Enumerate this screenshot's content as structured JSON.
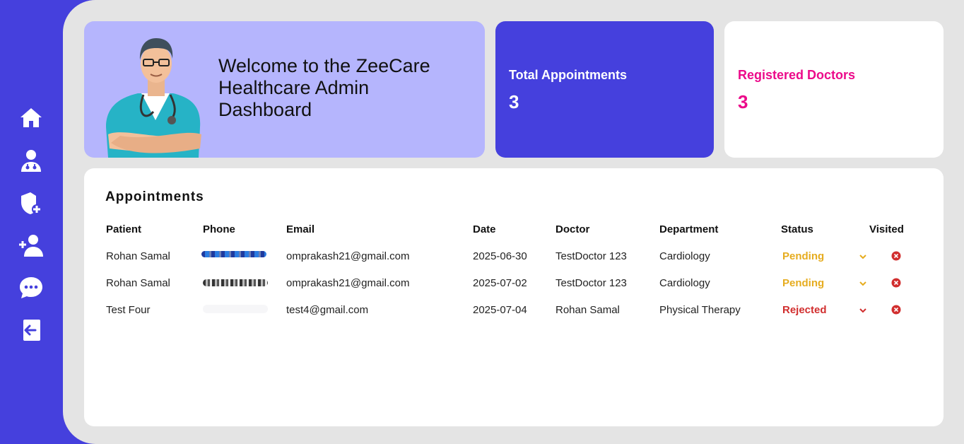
{
  "sidebar": {
    "items": [
      {
        "icon": "home-icon"
      },
      {
        "icon": "doctor-icon"
      },
      {
        "icon": "add-admin-shield-icon"
      },
      {
        "icon": "add-doctor-icon"
      },
      {
        "icon": "messages-icon"
      },
      {
        "icon": "logout-icon"
      }
    ]
  },
  "welcome": {
    "line1": "Welcome to the ZeeCare",
    "line2": "Healthcare Admin",
    "line3": "Dashboard"
  },
  "stats": {
    "appointments_label": "Total Appointments",
    "appointments_value": "3",
    "doctors_label": "Registered Doctors",
    "doctors_value": "3"
  },
  "appointments": {
    "title": "Appointments",
    "headers": {
      "patient": "Patient",
      "phone": "Phone",
      "email": "Email",
      "date": "Date",
      "doctor": "Doctor",
      "department": "Department",
      "status": "Status",
      "visited": "Visited"
    },
    "rows": [
      {
        "patient": "Rohan Samal",
        "email": "omprakash21@gmail.com",
        "date": "2025-06-30",
        "doctor": "TestDoctor 123",
        "department": "Cardiology",
        "status": "Pending"
      },
      {
        "patient": "Rohan Samal",
        "email": "omprakash21@gmail.com",
        "date": "2025-07-02",
        "doctor": "TestDoctor 123",
        "department": "Cardiology",
        "status": "Pending"
      },
      {
        "patient": "Test Four",
        "email": "test4@gmail.com",
        "date": "2025-07-04",
        "doctor": "Rohan Samal",
        "department": "Physical Therapy",
        "status": "Rejected"
      }
    ]
  },
  "colors": {
    "brand": "#4540dd",
    "welcome_bg": "#b5b5fd",
    "pending": "#e6ac1f",
    "rejected": "#d12e2e",
    "doctors_accent": "#ec0a8a"
  }
}
